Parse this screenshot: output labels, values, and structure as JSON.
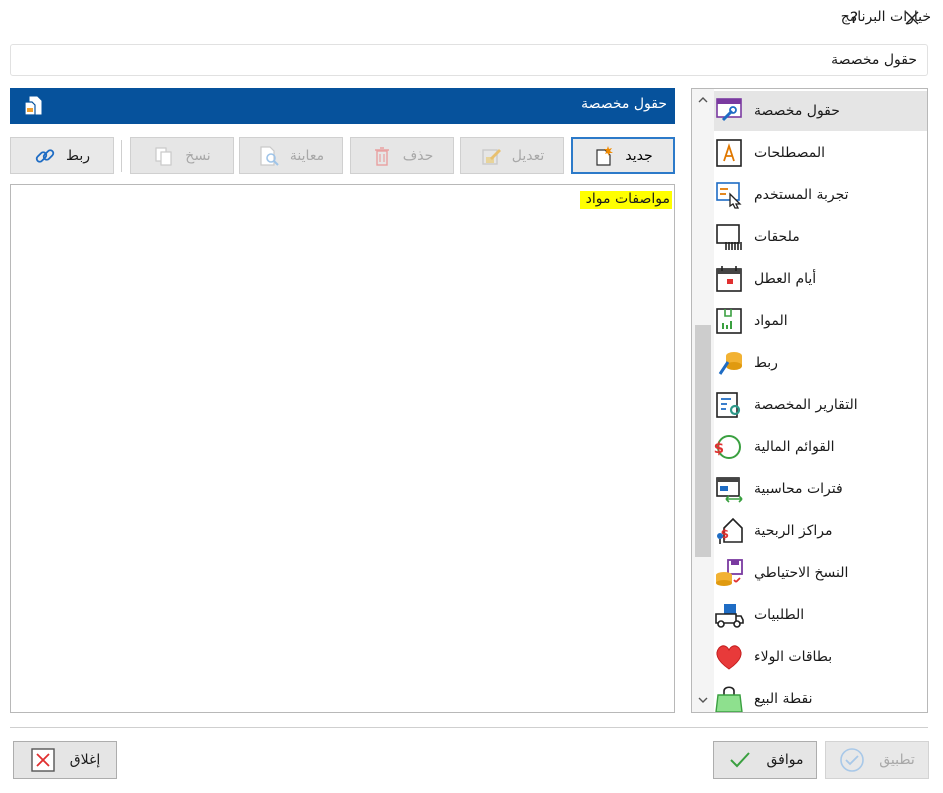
{
  "window": {
    "title": "خيارات البرنامج",
    "help_label": "?",
    "close_label": "✕"
  },
  "breadcrumb": {
    "text": "حقول مخصصة"
  },
  "section": {
    "title": "حقول مخصصة"
  },
  "toolbar": {
    "new_label": "جديد",
    "edit_label": "تعديل",
    "delete_label": "حذف",
    "preview_label": "معاينة",
    "copy_label": "نسخ",
    "link_label": "ربط"
  },
  "content": {
    "items": [
      "مواصفات مواد"
    ]
  },
  "sidebar": {
    "items": [
      {
        "label": "حقول مخصصة",
        "icon": "custom-fields-icon"
      },
      {
        "label": "المصطلحات",
        "icon": "terms-icon"
      },
      {
        "label": "تجربة المستخدم",
        "icon": "user-experience-icon"
      },
      {
        "label": "ملحقات",
        "icon": "attachments-icon"
      },
      {
        "label": "أيام العطل",
        "icon": "calendar-icon"
      },
      {
        "label": "المواد",
        "icon": "materials-box-icon"
      },
      {
        "label": "ربط",
        "icon": "link-coins-icon"
      },
      {
        "label": "التقارير المخصصة",
        "icon": "custom-reports-icon"
      },
      {
        "label": "القوائم المالية",
        "icon": "financial-statements-icon"
      },
      {
        "label": "فترات محاسبية",
        "icon": "accounting-periods-icon"
      },
      {
        "label": "مراكز الربحية",
        "icon": "profit-centers-icon"
      },
      {
        "label": "النسخ الاحتياطي",
        "icon": "backup-icon"
      },
      {
        "label": "الطلبيات",
        "icon": "orders-truck-icon"
      },
      {
        "label": "بطاقات الولاء",
        "icon": "loyalty-heart-icon"
      },
      {
        "label": "نقطة البيع",
        "icon": "pos-bag-icon"
      }
    ]
  },
  "footer": {
    "apply_label": "تطبيق",
    "ok_label": "موافق",
    "close_label": "إغلاق"
  },
  "colors": {
    "header_bg": "#06529c",
    "highlight": "#ffff00",
    "focus_border": "#2c7ac9"
  }
}
